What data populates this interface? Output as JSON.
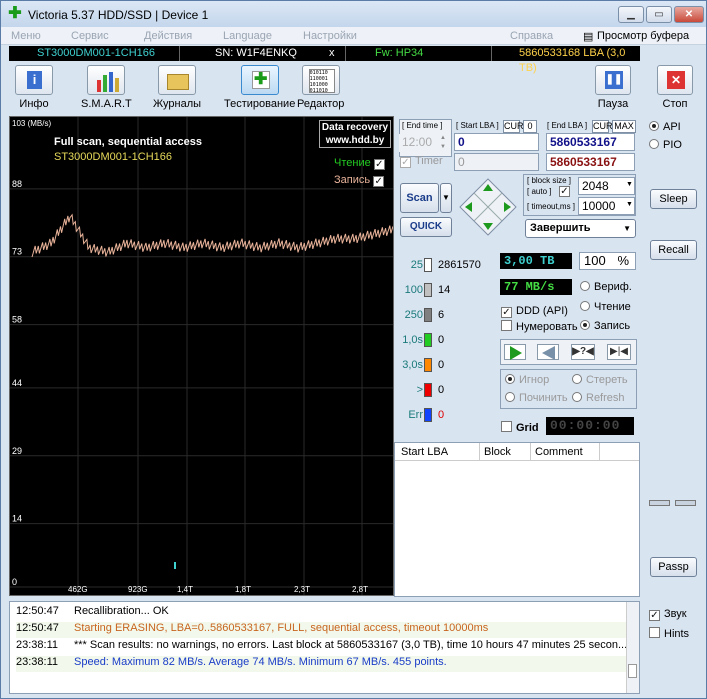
{
  "window": {
    "title": "Victoria 5.37 HDD/SSD | Device 1",
    "min": "▁",
    "max": "▭",
    "close": "✕"
  },
  "menu": {
    "items": [
      "Меню",
      "Сервис",
      "Действия",
      "Language",
      "Настройки",
      "Справка"
    ],
    "clipboard": "Просмотр буфера"
  },
  "drive": {
    "model": "ST3000DM001-1CH166",
    "serial": "SN: W1F4ENKQ",
    "x": "x",
    "fw": "Fw: HP34",
    "lba": "5860533168 LBA (3,0 TB)"
  },
  "toolbar": {
    "info": "Инфо",
    "smart": "S.M.A.R.T",
    "logs": "Журналы",
    "test": "Тестирование",
    "editor": "Редактор",
    "pause": "Пауза",
    "stop": "Стоп",
    "editor_icon_text": "010110\n110001\n101000\n011010"
  },
  "graph": {
    "unit": "103 (MB/s)",
    "title": "Full scan, sequential access",
    "model": "ST3000DM001-1CH166",
    "watermark1": "Data recovery",
    "watermark2": "www.hdd.by",
    "read": "Чтение",
    "write": "Запись",
    "y_ticks": [
      "88",
      "73",
      "58",
      "44",
      "29",
      "14",
      "0"
    ],
    "x_ticks": [
      "462G",
      "923G",
      "1,4T",
      "1,8T",
      "2,3T",
      "2,8T"
    ]
  },
  "chart_data": {
    "type": "line",
    "ylabel": "MB/s",
    "ylim": [
      0,
      103
    ],
    "x_ticks": [
      "462G",
      "923G",
      "1,4T",
      "1,8T",
      "2,3T",
      "2,8T"
    ],
    "series": [
      {
        "name": "Запись",
        "values": [
          74,
          76,
          82,
          75,
          74,
          76,
          75,
          76,
          75,
          76,
          75,
          76,
          75,
          76,
          75,
          76,
          77,
          77,
          78,
          79
        ]
      }
    ]
  },
  "range": {
    "end_time_label": "End time",
    "start_lba_label": "Start LBA",
    "cur": "CUR",
    "zero": "0",
    "end_lba_label": "End LBA",
    "max": "MAX",
    "time_value": "12:00",
    "start_lba": "0",
    "end_lba": "5860533167",
    "end_lba_cur": "5860533167",
    "timer_label": "Timer",
    "timer_value": "0"
  },
  "scan": {
    "scan": "Scan",
    "quick": "QUICK",
    "block_size_label": "[ block size ]",
    "auto": "[ auto ]",
    "block_size": "2048",
    "timeout_label": "timeout,ms",
    "timeout": "10000",
    "finish": "Завершить"
  },
  "stats": [
    {
      "k": "25",
      "v": "2861570",
      "color": "#ffffff"
    },
    {
      "k": "100",
      "v": "14",
      "color": "#c0c0c0"
    },
    {
      "k": "250",
      "v": "6",
      "color": "#808080"
    },
    {
      "k": "1,0s",
      "v": "0",
      "color": "#22cc22"
    },
    {
      "k": "3,0s",
      "v": "0",
      "color": "#ff8800"
    },
    {
      "k": ">",
      "v": "0",
      "color": "#ee0000"
    },
    {
      "k": "Err",
      "v": "0",
      "color": "#1144ff"
    }
  ],
  "status": {
    "size": "3,00 TB",
    "percent": "100",
    "pct": "%",
    "speed": "77 MB/s",
    "verify": "Вериф.",
    "read": "Чтение",
    "write": "Запись",
    "ddd": "DDD (API)",
    "numbering": "Нумеровать",
    "ignore": "Игнор",
    "erase": "Стереть",
    "repair": "Починить",
    "refresh": "Refresh",
    "grid": "Grid",
    "timer": "00:00:00"
  },
  "table": {
    "cols": [
      "Start LBA",
      "Block",
      "Comment"
    ]
  },
  "side": {
    "api": "API",
    "pio": "PIO",
    "sleep": "Sleep",
    "recall": "Recall",
    "passp": "Passp",
    "sound": "Звук",
    "hints": "Hints"
  },
  "log": [
    {
      "t": "12:50:47",
      "m": "Recallibration... OK",
      "c": "#000000"
    },
    {
      "t": "12:50:47",
      "m": "Starting ERASING, LBA=0..5860533167, FULL, sequential access, timeout 10000ms",
      "c": "#c8641e"
    },
    {
      "t": "23:38:11",
      "m": "*** Scan results: no warnings, no errors. Last block at 5860533167 (3,0 TB), time 10 hours 47 minutes 25 secon...",
      "c": "#000000"
    },
    {
      "t": "23:38:11",
      "m": "Speed: Maximum 82 MB/s. Average 74 MB/s. Minimum 67 MB/s. 455 points.",
      "c": "#1a3cc8"
    }
  ]
}
